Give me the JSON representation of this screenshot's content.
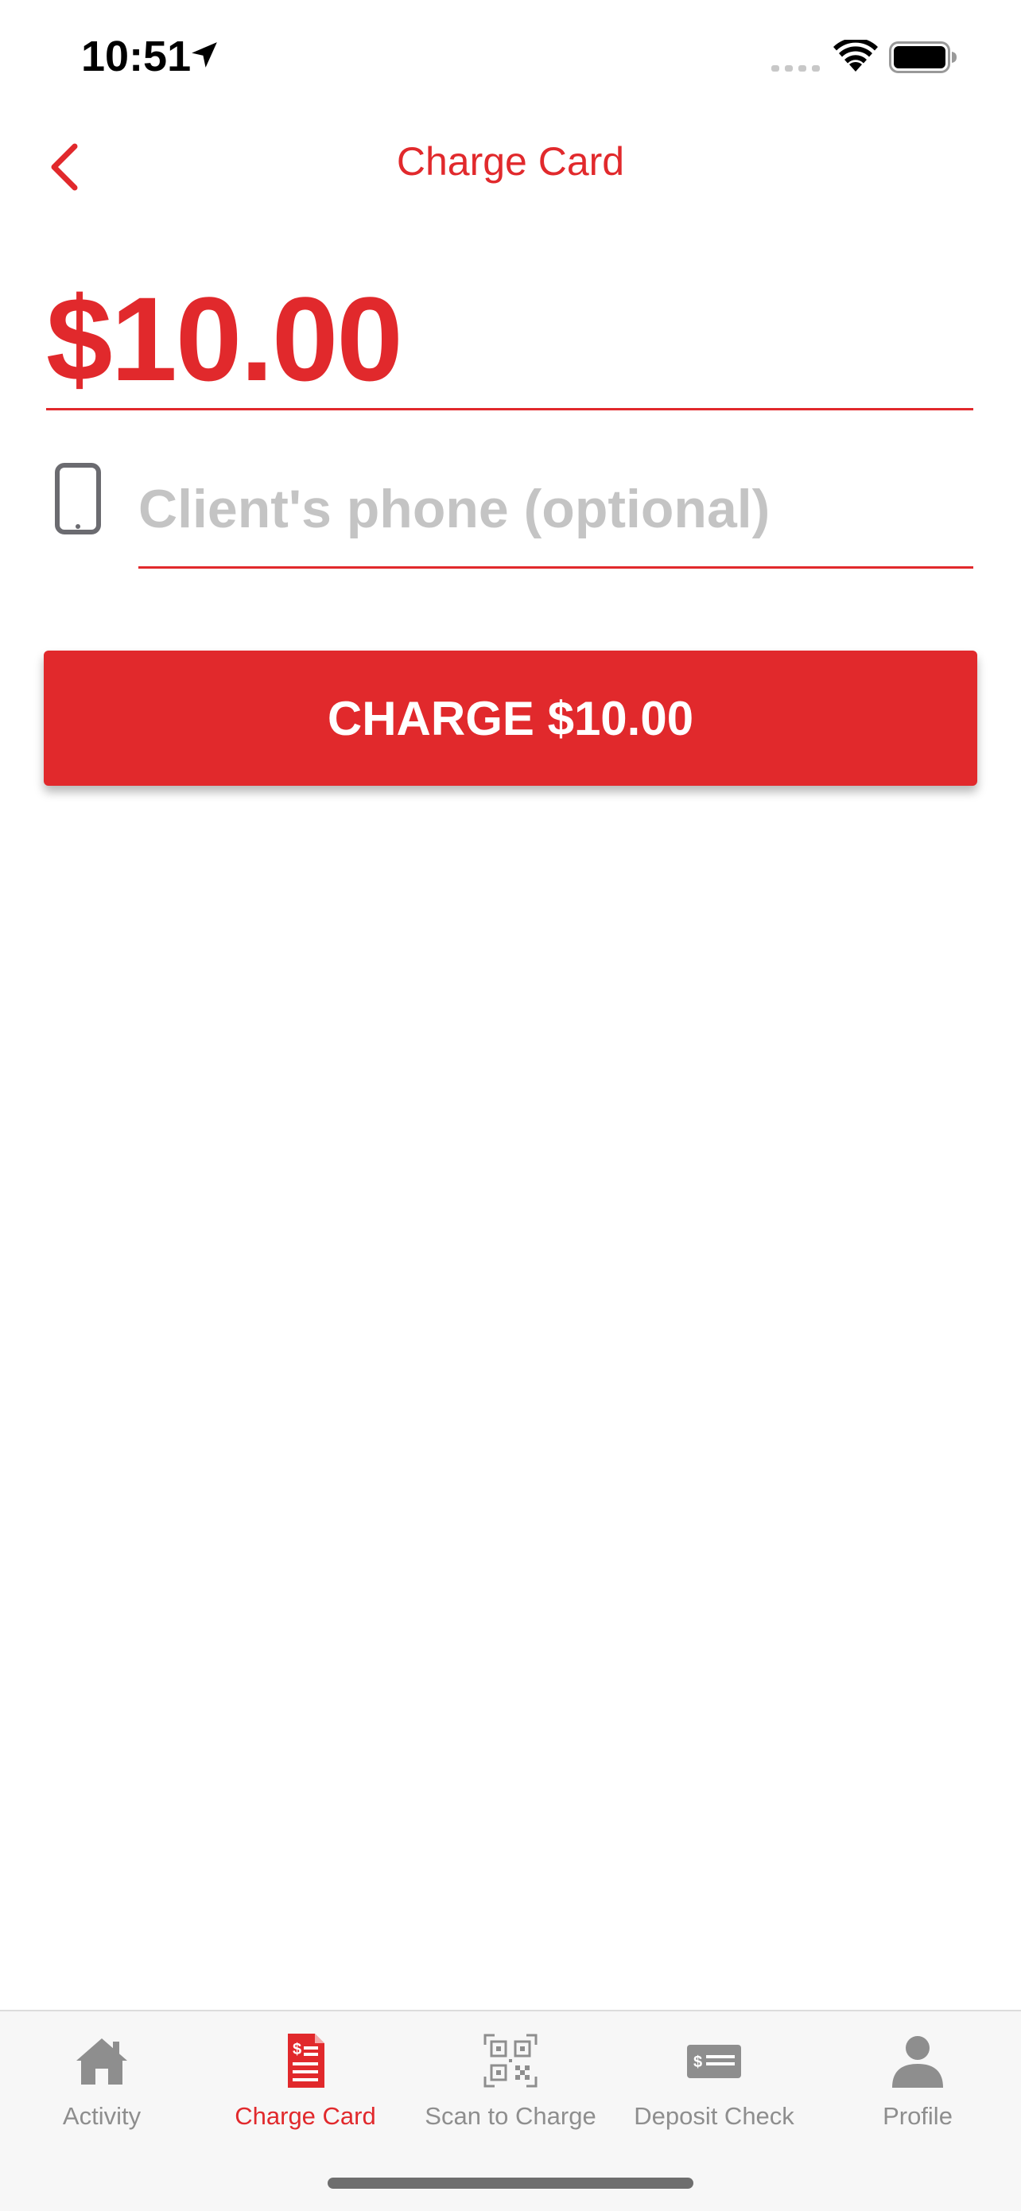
{
  "status_bar": {
    "time": "10:51",
    "icons": [
      "location-arrow-icon",
      "cellular-signal-icon",
      "wifi-icon",
      "battery-icon"
    ]
  },
  "header": {
    "title": "Charge Card",
    "back_icon": "chevron-left-icon"
  },
  "amount": {
    "value": "$10.00"
  },
  "phone": {
    "placeholder": "Client's phone (optional)",
    "value": "",
    "icon": "smartphone-icon"
  },
  "charge_button": {
    "label": "CHARGE $10.00"
  },
  "tab_bar": {
    "active": "Charge Card",
    "items": [
      {
        "label": "Activity",
        "icon": "home-icon"
      },
      {
        "label": "Charge Card",
        "icon": "invoice-dollar-icon"
      },
      {
        "label": "Scan to Charge",
        "icon": "qr-code-icon"
      },
      {
        "label": "Deposit Check",
        "icon": "check-dollar-icon"
      },
      {
        "label": "Profile",
        "icon": "person-icon"
      }
    ]
  },
  "colors": {
    "accent": "#e1292c",
    "tab_inactive": "#8e8e8e",
    "placeholder": "#c4c4c4"
  }
}
